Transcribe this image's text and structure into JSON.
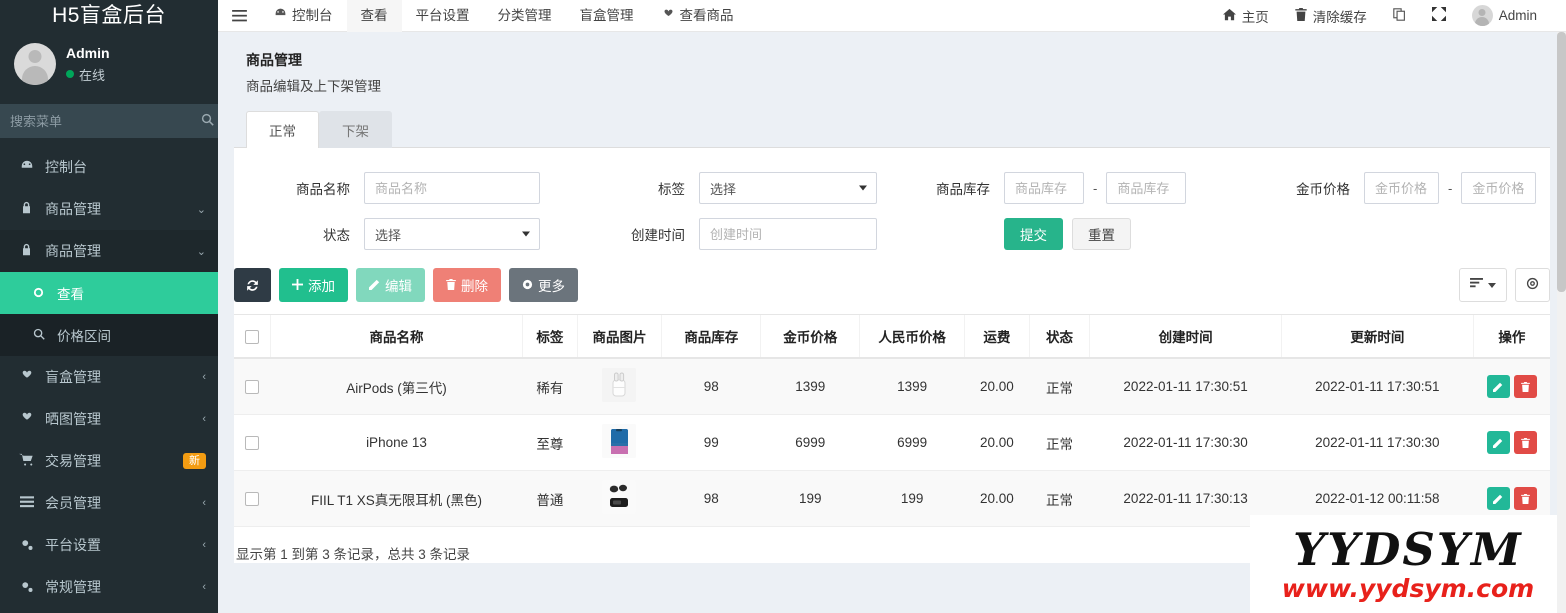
{
  "sidebar": {
    "brand": "H5盲盒后台",
    "user": {
      "name": "Admin",
      "status": "在线"
    },
    "search": {
      "placeholder": "搜索菜单",
      "icon": "search-icon"
    },
    "items": [
      {
        "label": "控制台",
        "icon": "dashboard-icon",
        "arrow": "",
        "state": "normal"
      },
      {
        "label": "商品管理",
        "icon": "lock-icon",
        "arrow": "⌄",
        "state": "normal"
      },
      {
        "label": "商品管理",
        "icon": "lock-icon",
        "arrow": "⌄",
        "state": "open"
      },
      {
        "label": "查看",
        "icon": "circle-icon",
        "arrow": "",
        "state": "active-sub"
      },
      {
        "label": "价格区间",
        "icon": "search-icon",
        "arrow": "",
        "state": "sub"
      },
      {
        "label": "盲盒管理",
        "icon": "gift-icon",
        "arrow": "‹",
        "state": "normal"
      },
      {
        "label": "晒图管理",
        "icon": "gift-icon",
        "arrow": "‹",
        "state": "normal"
      },
      {
        "label": "交易管理",
        "icon": "cart-icon",
        "arrow": "",
        "badge": "新",
        "state": "normal"
      },
      {
        "label": "会员管理",
        "icon": "list-icon",
        "arrow": "‹",
        "state": "normal"
      },
      {
        "label": "平台设置",
        "icon": "gears-icon",
        "arrow": "‹",
        "state": "normal"
      },
      {
        "label": "常规管理",
        "icon": "gears-icon",
        "arrow": "‹",
        "state": "normal"
      }
    ]
  },
  "topbar": {
    "hamburger_icon": "hamburger-icon",
    "nav": [
      {
        "label": "控制台",
        "icon": "dashboard-icon",
        "selected": false
      },
      {
        "label": "查看",
        "icon": "",
        "selected": true
      },
      {
        "label": "平台设置",
        "icon": "",
        "selected": false
      },
      {
        "label": "分类管理",
        "icon": "",
        "selected": false
      },
      {
        "label": "盲盒管理",
        "icon": "",
        "selected": false
      },
      {
        "label": "查看商品",
        "icon": "gift-icon",
        "selected": false
      }
    ],
    "right": [
      {
        "label": "主页",
        "icon": "home-icon"
      },
      {
        "label": "清除缓存",
        "icon": "trash-icon"
      },
      {
        "label": "",
        "icon": "copy-icon"
      },
      {
        "label": "",
        "icon": "expand-icon"
      },
      {
        "label": "Admin",
        "icon": "avatar-icon"
      }
    ]
  },
  "page": {
    "title": "商品管理",
    "subtitle": "商品编辑及上下架管理",
    "tabs": [
      {
        "label": "正常",
        "active": true
      },
      {
        "label": "下架",
        "active": false
      }
    ]
  },
  "filters": {
    "product_name": {
      "label": "商品名称",
      "placeholder": "商品名称",
      "value": ""
    },
    "tag": {
      "label": "标签",
      "selected": "选择"
    },
    "stock": {
      "label": "商品库存",
      "placeholder_min": "商品库存",
      "placeholder_max": "商品库存",
      "separator": "-"
    },
    "coin_price": {
      "label": "金币价格",
      "placeholder_min": "金币价格",
      "placeholder_max": "金币价格",
      "separator": "-"
    },
    "status": {
      "label": "状态",
      "selected": "选择"
    },
    "create_time": {
      "label": "创建时间",
      "placeholder": "创建时间",
      "value": ""
    },
    "submit": "提交",
    "reset": "重置"
  },
  "toolbar": {
    "refresh_icon": "refresh-icon",
    "add": "添加",
    "edit": "编辑",
    "delete": "删除",
    "more": "更多",
    "columns_icon": "columns-icon",
    "settings_icon": "gear-icon"
  },
  "table": {
    "columns": [
      "",
      "商品名称",
      "标签",
      "商品图片",
      "商品库存",
      "金币价格",
      "人民币价格",
      "运费",
      "状态",
      "创建时间",
      "更新时间",
      "操作"
    ],
    "rows": [
      {
        "name": "AirPods (第三代)",
        "tag": "稀有",
        "tag_color": "#4fc3a1",
        "image": "airpods-thumbnail",
        "stock": "98",
        "coin_price": "1399",
        "rmb_price": "1399",
        "shipping": "20.00",
        "status": "正常",
        "created_at": "2022-01-11 17:30:51",
        "updated_at": "2022-01-11 17:30:51"
      },
      {
        "name": "iPhone 13",
        "tag": "至尊",
        "tag_color": "#ea7b6a",
        "image": "iphone-thumbnail",
        "stock": "99",
        "coin_price": "6999",
        "rmb_price": "6999",
        "shipping": "20.00",
        "status": "正常",
        "created_at": "2022-01-11 17:30:30",
        "updated_at": "2022-01-11 17:30:30"
      },
      {
        "name": "FIIL T1 XS真无限耳机 (黑色)",
        "tag": "普通",
        "tag_color": "#555555",
        "image": "earbuds-thumbnail",
        "stock": "98",
        "coin_price": "199",
        "rmb_price": "199",
        "shipping": "20.00",
        "status": "正常",
        "created_at": "2022-01-11 17:30:13",
        "updated_at": "2022-01-12 00:11:58"
      }
    ],
    "footer": "显示第 1 到第 3 条记录，总共 3 条记录"
  },
  "watermark": {
    "title": "YYDSYM",
    "url": "www.yydsym.com"
  },
  "colors": {
    "sidebar_bg": "#222d32",
    "accent_green": "#2ecc9b",
    "submit_green": "#27b48b",
    "delete_red": "#e14b46",
    "badge_orange": "#f39c12"
  }
}
